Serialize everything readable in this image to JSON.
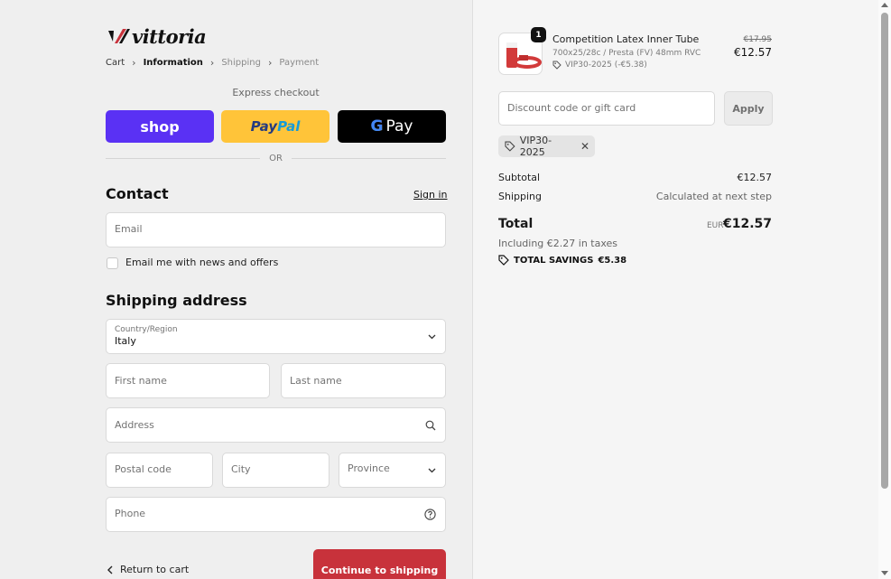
{
  "brand": {
    "name": "vittoria",
    "accent_color": "#c8323b"
  },
  "breadcrumb": [
    {
      "label": "Cart",
      "state": "link"
    },
    {
      "label": "Information",
      "state": "active"
    },
    {
      "label": "Shipping",
      "state": "inactive"
    },
    {
      "label": "Payment",
      "state": "inactive"
    }
  ],
  "express": {
    "label": "Express checkout",
    "shop_label": "shop",
    "paypal_part1": "Pay",
    "paypal_part2": "Pal",
    "gpay_g": "G",
    "gpay_label": "Pay",
    "or_label": "OR"
  },
  "contact": {
    "title": "Contact",
    "signin_label": "Sign in",
    "email_placeholder": "Email",
    "newsletter_label": "Email me with news and offers",
    "newsletter_checked": false
  },
  "shipping": {
    "title": "Shipping address",
    "country_label": "Country/Region",
    "country_value": "Italy",
    "first_name_placeholder": "First name",
    "last_name_placeholder": "Last name",
    "address_placeholder": "Address",
    "postal_placeholder": "Postal code",
    "city_placeholder": "City",
    "province_placeholder": "Province",
    "phone_placeholder": "Phone"
  },
  "actions": {
    "return_label": "Return to cart",
    "continue_label": "Continue to shipping"
  },
  "order": {
    "quantity": "1",
    "product_name": "Competition Latex Inner Tube",
    "variant": "700x25/28c / Presta (FV) 48mm RVC",
    "item_discount": "VIP30-2025 (-€5.38)",
    "old_price": "€17.95",
    "price": "€12.57"
  },
  "discount": {
    "placeholder": "Discount code or gift card",
    "apply_label": "Apply",
    "applied_code": "VIP30-2025"
  },
  "summary": {
    "subtotal_label": "Subtotal",
    "subtotal_value": "€12.57",
    "shipping_label": "Shipping",
    "shipping_value": "Calculated at next step",
    "total_label": "Total",
    "currency": "EUR",
    "total_value": "€12.57",
    "taxes_text": "Including €2.27 in taxes",
    "savings_label": "TOTAL SAVINGS",
    "savings_value": "€5.38"
  }
}
